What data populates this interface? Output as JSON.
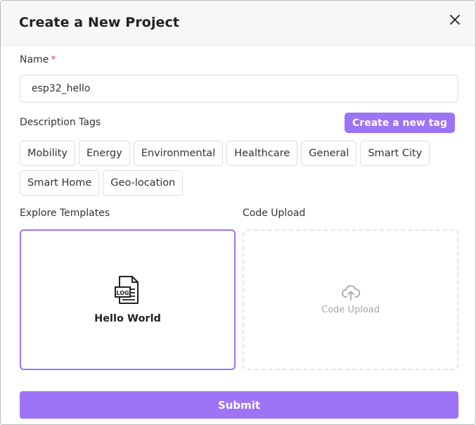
{
  "dialog": {
    "title": "Create a New Project",
    "close_icon": "close-icon"
  },
  "form": {
    "name_label": "Name",
    "required_marker": "*",
    "name_value": "esp32_hello",
    "description_tags_label": "Description Tags",
    "create_tag_label": "Create a new tag",
    "tags": [
      "Mobility",
      "Energy",
      "Environmental",
      "Healthcare",
      "General",
      "Smart City",
      "Smart Home",
      "Geo-location"
    ],
    "explore_templates_label": "Explore Templates",
    "code_upload_label": "Code Upload",
    "template": {
      "label": "Hello World",
      "icon": "log-file-icon",
      "icon_text": "LOG"
    },
    "upload": {
      "label": "Code Upload",
      "icon": "cloud-upload-icon"
    },
    "submit_label": "Submit"
  },
  "colors": {
    "accent": "#9c74f5",
    "required": "#e5484d",
    "header_bg": "#f7f7f7"
  }
}
